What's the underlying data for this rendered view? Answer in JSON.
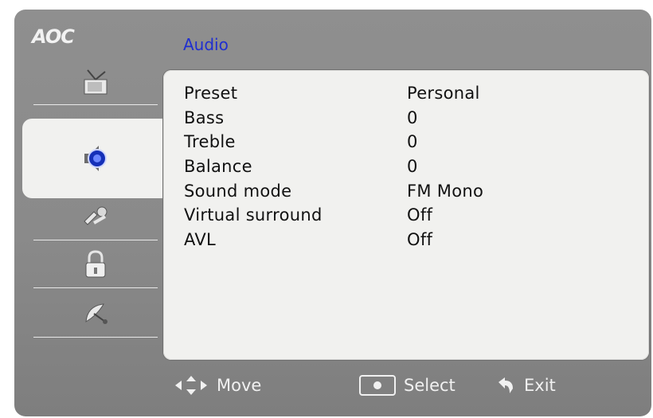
{
  "brand": {
    "logo_text": "AOC"
  },
  "header": {
    "section_title": "Audio"
  },
  "sidebar": {
    "items": [
      {
        "icon": "tv-antenna-icon",
        "active": false
      },
      {
        "icon": "speaker-icon",
        "active": true
      },
      {
        "icon": "tools-icon",
        "active": false
      },
      {
        "icon": "lock-icon",
        "active": false
      },
      {
        "icon": "satellite-dish-icon",
        "active": false
      }
    ]
  },
  "menu": {
    "rows": [
      {
        "label": "Preset",
        "value": "Personal"
      },
      {
        "label": "Bass",
        "value": "0"
      },
      {
        "label": "Treble",
        "value": "0"
      },
      {
        "label": "Balance",
        "value": "0"
      },
      {
        "label": "Sound mode",
        "value": "FM Mono"
      },
      {
        "label": "Virtual surround",
        "value": "Off"
      },
      {
        "label": "AVL",
        "value": "Off"
      }
    ]
  },
  "footer": {
    "move_label": "Move",
    "select_label": "Select",
    "exit_label": "Exit"
  },
  "colors": {
    "frame": "#8a8a8a",
    "panel": "#f1f1ef",
    "title_blue": "#1f2fd0",
    "text_dark": "#111111",
    "text_light": "#f1f1f1"
  }
}
